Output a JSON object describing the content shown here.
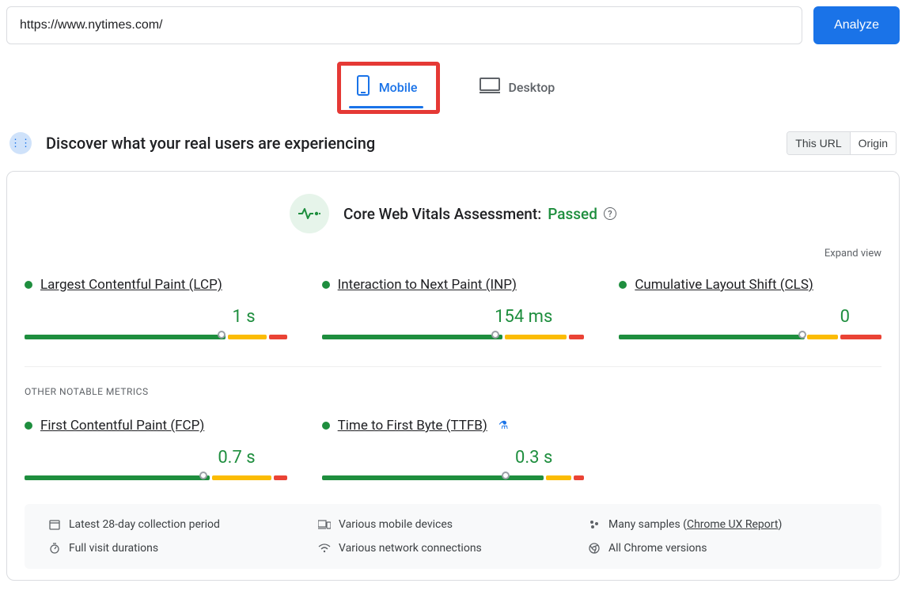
{
  "url_value": "https://www.nytimes.com/",
  "analyze_label": "Analyze",
  "tabs": {
    "mobile": "Mobile",
    "desktop": "Desktop"
  },
  "section_title": "Discover what your real users are experiencing",
  "toggle": {
    "this_url": "This URL",
    "origin": "Origin"
  },
  "vitals": {
    "title_prefix": "Core Web Vitals Assessment: ",
    "status": "Passed",
    "expand": "Expand view"
  },
  "metrics_main": [
    {
      "name": "Largest Contentful Paint (LCP)",
      "value": "1 s",
      "good": 78,
      "amber": 15,
      "red": 7,
      "marker": 75,
      "experimental": false
    },
    {
      "name": "Interaction to Next Paint (INP)",
      "value": "154 ms",
      "good": 70,
      "amber": 24,
      "red": 6,
      "marker": 66,
      "experimental": false
    },
    {
      "name": "Cumulative Layout Shift (CLS)",
      "value": "0",
      "good": 72,
      "amber": 12,
      "red": 16,
      "marker": 70,
      "experimental": false
    }
  ],
  "other_header": "OTHER NOTABLE METRICS",
  "metrics_other": [
    {
      "name": "First Contentful Paint (FCP)",
      "value": "0.7 s",
      "good": 72,
      "amber": 23,
      "red": 5,
      "marker": 68,
      "experimental": false
    },
    {
      "name": "Time to First Byte (TTFB)",
      "value": "0.3 s",
      "good": 86,
      "amber": 10,
      "red": 4,
      "marker": 70,
      "experimental": true
    }
  ],
  "footer": {
    "r1c1": "Latest 28-day collection period",
    "r1c2": "Various mobile devices",
    "r1c3_prefix": "Many samples (",
    "r1c3_link": "Chrome UX Report",
    "r1c3_suffix": ")",
    "r2c1": "Full visit durations",
    "r2c2": "Various network connections",
    "r2c3": "All Chrome versions"
  }
}
